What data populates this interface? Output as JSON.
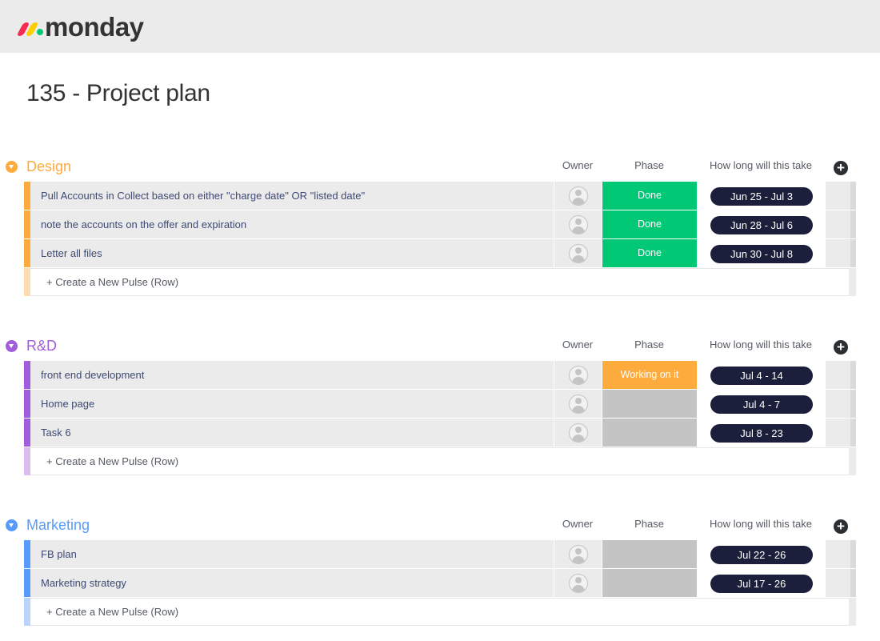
{
  "app": {
    "logo_text": "monday",
    "logo_colors": [
      "#f62b54",
      "#ffcc00",
      "#00ca72"
    ]
  },
  "board": {
    "title": "135 - Project plan"
  },
  "columns": {
    "owner": "Owner",
    "phase": "Phase",
    "timeline": "How long will this take"
  },
  "new_row_label": "+ Create a New Pulse (Row)",
  "status_colors": {
    "done": "#00c875",
    "working": "#fdab3d",
    "empty": "#c4c4c4"
  },
  "groups": [
    {
      "name": "Design",
      "color": "#fdab3d",
      "light_color": "#fedcb0",
      "rows": [
        {
          "name": "Pull Accounts in Collect based on either \"charge date\" OR \"listed date\"",
          "phase": "Done",
          "phase_color": "#00c875",
          "timeline": "Jun 25 - Jul 3"
        },
        {
          "name": "note the accounts on the offer and expiration",
          "phase": "Done",
          "phase_color": "#00c875",
          "timeline": "Jun 28 - Jul 6"
        },
        {
          "name": "Letter all files",
          "phase": "Done",
          "phase_color": "#00c875",
          "timeline": "Jun 30 - Jul 8"
        }
      ]
    },
    {
      "name": "R&D",
      "color": "#a25ddc",
      "light_color": "#d9bdf1",
      "rows": [
        {
          "name": "front end development",
          "phase": "Working on it",
          "phase_color": "#fdab3d",
          "timeline": "Jul 4 - 14"
        },
        {
          "name": "Home page",
          "phase": "",
          "phase_color": "#c4c4c4",
          "timeline": "Jul 4 - 7"
        },
        {
          "name": "Task 6",
          "phase": "",
          "phase_color": "#c4c4c4",
          "timeline": "Jul 8 - 23"
        }
      ]
    },
    {
      "name": "Marketing",
      "color": "#579bfc",
      "light_color": "#b9d5fe",
      "rows": [
        {
          "name": "FB plan",
          "phase": "",
          "phase_color": "#c4c4c4",
          "timeline": "Jul 22 - 26"
        },
        {
          "name": "Marketing strategy",
          "phase": "",
          "phase_color": "#c4c4c4",
          "timeline": "Jul 17 - 26"
        }
      ]
    }
  ]
}
